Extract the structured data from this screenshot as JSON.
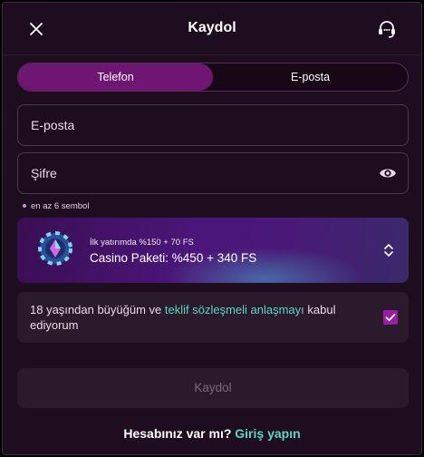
{
  "header": {
    "title": "Kaydol",
    "close_icon": "close-icon",
    "support_icon": "headset-icon"
  },
  "tabs": [
    {
      "label": "Telefon",
      "active": true
    },
    {
      "label": "E-posta",
      "active": false
    }
  ],
  "form": {
    "email_placeholder": "E-posta",
    "password_placeholder": "Şifre",
    "password_hint": "en az 6 sembol"
  },
  "bonus": {
    "subtitle": "İlk yatırımda %150 + 70 FS",
    "title": "Casino Paketi: %450 + 340 FS"
  },
  "terms": {
    "text_before": "18 yaşından büyüğüm ve ",
    "link": "teklif sözleşmeli anlaşmayı",
    "text_after": " kabul ediyorum",
    "checked": true
  },
  "submit_label": "Kaydol",
  "footer": {
    "question": "Hesabınız var mı?",
    "link": "Giriş yapın"
  },
  "colors": {
    "accent": "#9a1ea0",
    "link": "#58d7c1",
    "background": "#1e0c1f"
  }
}
